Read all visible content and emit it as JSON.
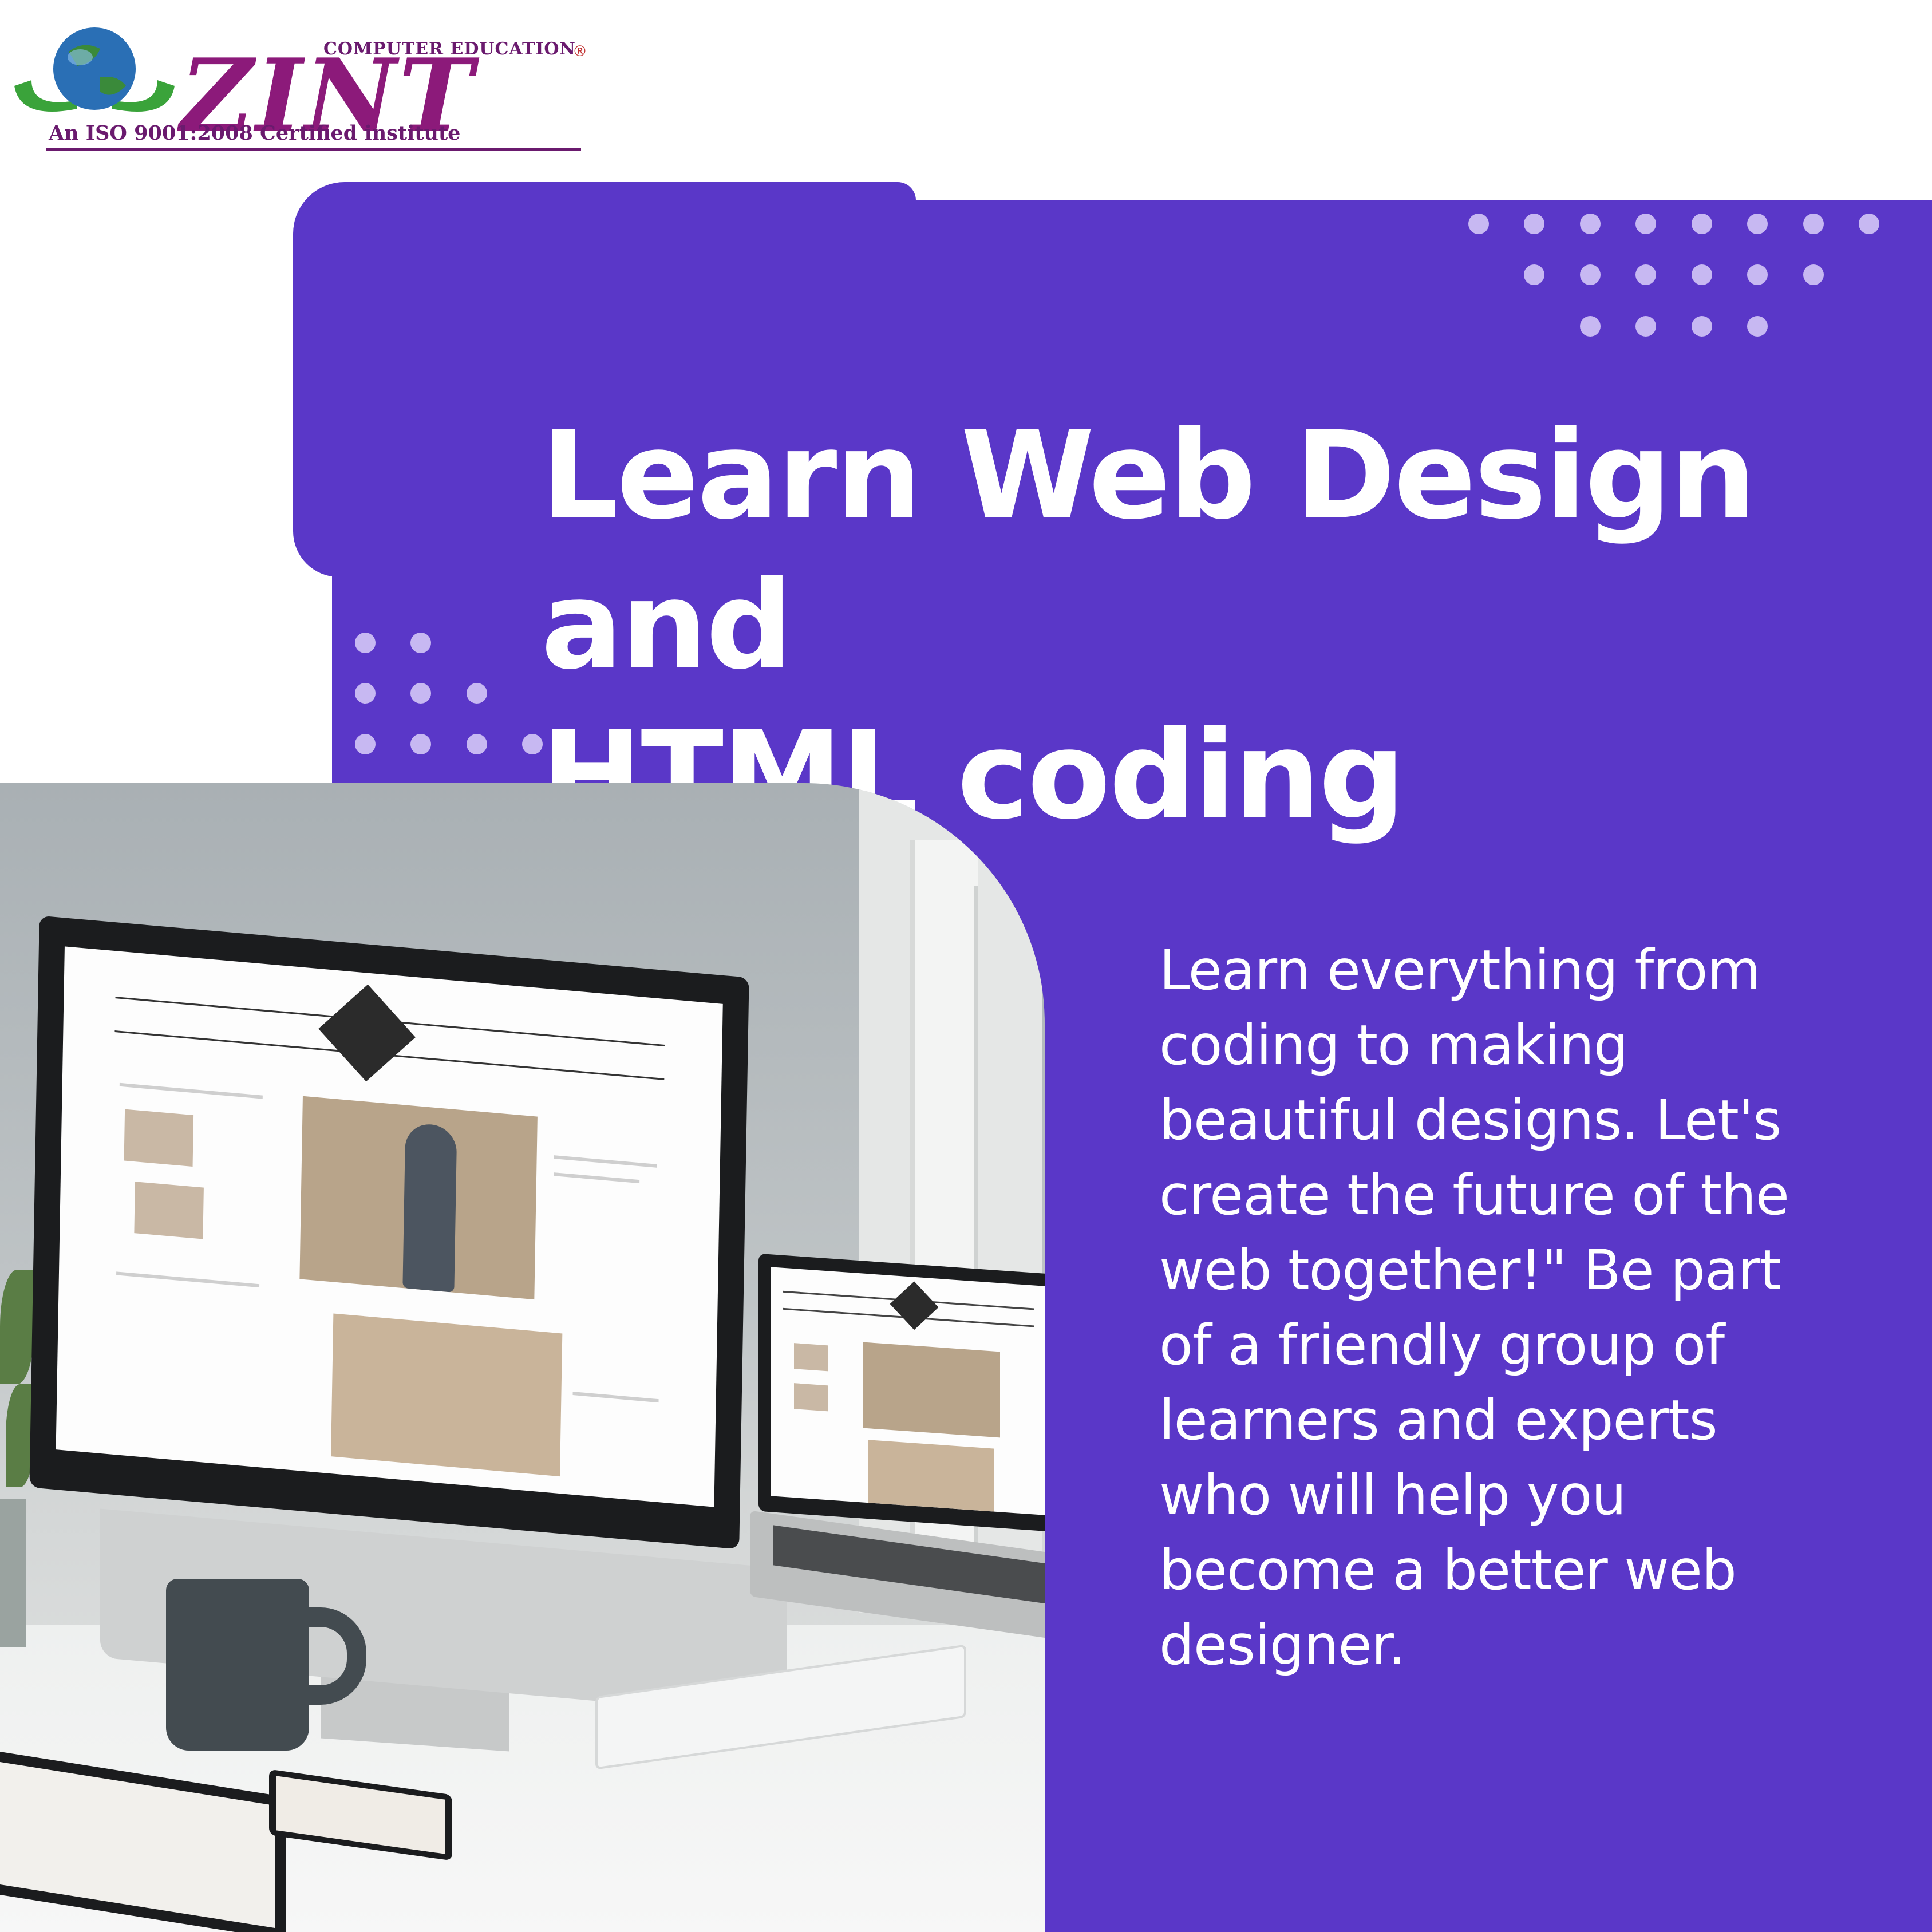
{
  "logo": {
    "top_text": "COMPUTER EDUCATION",
    "wordmark": "ZINT",
    "subtitle": "An ISO 9001:2008 Certified institute",
    "registered": "®",
    "colors": {
      "wordmark": "#8c1a7a",
      "globe": "#2a6fb5",
      "hands": "#3aa33a"
    }
  },
  "heading": {
    "line1": "Learn Web Design and",
    "line2": "HTML coding"
  },
  "body": {
    "lines": [
      "Learn everything from",
      "coding to making",
      "beautiful designs.  Let's",
      "create the future of the",
      "web together!\"  Be part",
      "of a friendly group of",
      "learners and experts",
      "who will help you",
      "become a better web",
      "designer."
    ]
  },
  "photo": {
    "description_icons": [
      "desktop-monitor-icon",
      "laptop-icon",
      "tablet-icon",
      "phone-icon",
      "mug-icon",
      "keyboard-icon"
    ]
  },
  "colors": {
    "accent": "#5a37c8",
    "dots": "#c7b8f2",
    "text": "#ffffff",
    "background": "#ffffff"
  }
}
